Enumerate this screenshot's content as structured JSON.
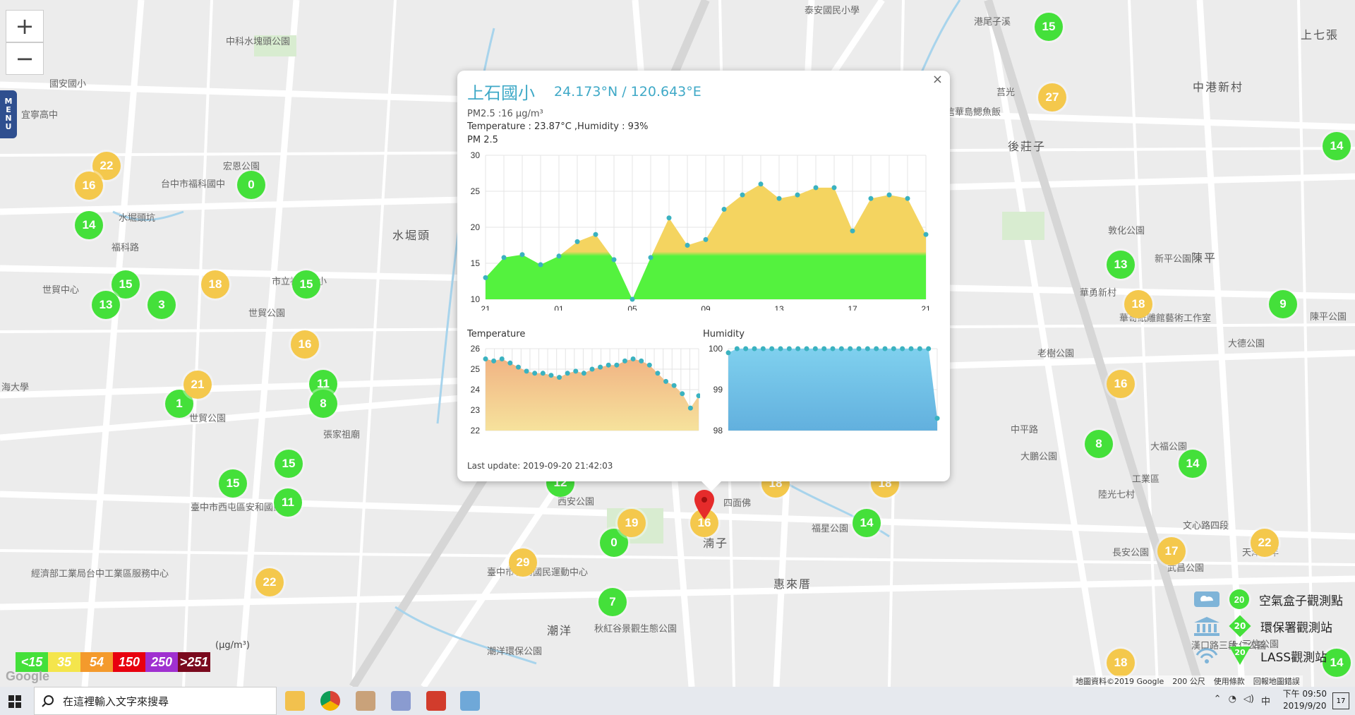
{
  "map": {
    "zoom_in": "+",
    "zoom_out": "−",
    "menu_label": [
      "M",
      "E",
      "N",
      "U"
    ],
    "labels": [
      "中科水塊頭公園",
      "泰安國民小學",
      "國安國小",
      "宜寧高中",
      "宏恩公園",
      "台中市福科國中",
      "水堀頭",
      "水堀頭坑",
      "福科路",
      "市立福安國小",
      "世貿公園",
      "世貿公園",
      "張家祖廟",
      "臺中市西屯區安和國民中學",
      "經濟部工業局台中工業區服務中心",
      "西安公園",
      "四面佛",
      "福星公園",
      "湳子",
      "惠來厝",
      "臺中市朝馬國民運動中心",
      "潮洋",
      "秋紅谷景觀生態公園",
      "潮洋環保公園",
      "港尾子溪",
      "後莊子",
      "中港新村",
      "上七張",
      "莒光",
      "華勇新村",
      "敦化公園",
      "新平公園",
      "華哥紙雕館藝術工作室",
      "陳平",
      "陳平公園",
      "大德公園",
      "老樹公園",
      "大福公園",
      "大鵬公園",
      "陸光七村",
      "中平路",
      "工業區",
      "文心路四段",
      "三信公園",
      "大仁公園",
      "長安公園",
      "武昌公園",
      "天津路年",
      "漢口路三段",
      "信華島鰓魚飯",
      "海大學",
      "世貿中心",
      "上石國小"
    ],
    "markers_green": [
      "15",
      "0",
      "14",
      "15",
      "15",
      "13",
      "3",
      "11",
      "8",
      "1",
      "15",
      "15",
      "11",
      "12",
      "0",
      "7",
      "14",
      "13",
      "14",
      "8",
      "9",
      "14",
      "14"
    ],
    "markers_yellow": [
      "27",
      "22",
      "16",
      "18",
      "16",
      "21",
      "18",
      "18",
      "19",
      "16",
      "29",
      "22",
      "17",
      "22",
      "18",
      "16",
      "18"
    ]
  },
  "scale": {
    "unit": "(μg/m³)",
    "levels": [
      {
        "label": "<15",
        "color": "#44e03a"
      },
      {
        "label": "35",
        "color": "#f4e54c"
      },
      {
        "label": "54",
        "color": "#f49a2c"
      },
      {
        "label": "150",
        "color": "#e8000f"
      },
      {
        "label": "250",
        "color": "#a030d0"
      },
      {
        "label": ">251",
        "color": "#7a0a1e"
      }
    ]
  },
  "legend": [
    {
      "label": "空氣盒子觀測點",
      "value": "20"
    },
    {
      "label": "環保署觀測站",
      "value": "20"
    },
    {
      "label": "LASS觀測站",
      "value": "20"
    }
  ],
  "attribution": {
    "data": "地圖資料©2019 Google",
    "scale": "200 公尺",
    "terms": "使用條款",
    "report": "回報地圖錯誤",
    "brand": "Google"
  },
  "popup": {
    "close": "×",
    "title": "上石國小",
    "coords": "24.173°N / 120.643°E",
    "pm_line": "PM2.5 :16 μg/m³",
    "temp_line": "Temperature : 23.87°C ,Humidity : 93%",
    "pm_chart_label": "PM 2.5",
    "temp_chart_label": "Temperature",
    "hum_chart_label": "Humidity",
    "last_update": "Last update: 2019-09-20 21:42:03"
  },
  "chart_data": [
    {
      "type": "area",
      "title": "PM 2.5",
      "x": [
        "21",
        "22",
        "23",
        "00",
        "01",
        "02",
        "03",
        "04",
        "05",
        "06",
        "07",
        "08",
        "09",
        "10",
        "11",
        "12",
        "13",
        "14",
        "15",
        "16",
        "17",
        "18",
        "19",
        "20",
        "21"
      ],
      "x_ticks": [
        "21",
        "01",
        "05",
        "09",
        "13",
        "17",
        "21"
      ],
      "values": [
        13,
        15.8,
        16.2,
        14.8,
        16,
        18,
        19,
        15.5,
        10,
        15.8,
        21.3,
        17.5,
        18.3,
        22.5,
        24.5,
        26,
        24,
        24.5,
        25.5,
        25.5,
        19.5,
        24,
        24.5,
        24,
        19
      ],
      "ylim": [
        10,
        30
      ],
      "y_ticks": [
        10,
        15,
        20,
        25,
        30
      ],
      "threshold": 16,
      "colors": {
        "low": "#54f23e",
        "high": "#f4d460",
        "point": "#3ab2c0"
      }
    },
    {
      "type": "area",
      "title": "Temperature",
      "values": [
        25.5,
        25.4,
        25.5,
        25.3,
        25.1,
        24.9,
        24.8,
        24.8,
        24.7,
        24.6,
        24.8,
        24.9,
        24.8,
        25,
        25.1,
        25.2,
        25.2,
        25.4,
        25.5,
        25.4,
        25.2,
        24.8,
        24.4,
        24.2,
        23.8,
        23.1,
        23.7
      ],
      "ylim": [
        22,
        26
      ],
      "y_ticks": [
        22,
        23,
        24,
        25,
        26
      ],
      "colors": {
        "top": "#f1b484",
        "bottom": "#f6e29c",
        "point": "#3ab2c0"
      }
    },
    {
      "type": "area",
      "title": "Humidity",
      "values": [
        99.9,
        100,
        100,
        100,
        100,
        100,
        100,
        100,
        100,
        100,
        100,
        100,
        100,
        100,
        100,
        100,
        100,
        100,
        100,
        100,
        100,
        100,
        100,
        100,
        98.3
      ],
      "ylim": [
        98,
        100
      ],
      "y_ticks": [
        98,
        99,
        100
      ],
      "colors": {
        "top": "#7fd0ee",
        "bottom": "#62b0de",
        "point": "#3ab2c0"
      }
    }
  ],
  "taskbar": {
    "search_placeholder": "在這裡輸入文字來搜尋",
    "time": "下午 09:50",
    "date": "2019/9/20",
    "ime": "中",
    "notif": "17"
  }
}
